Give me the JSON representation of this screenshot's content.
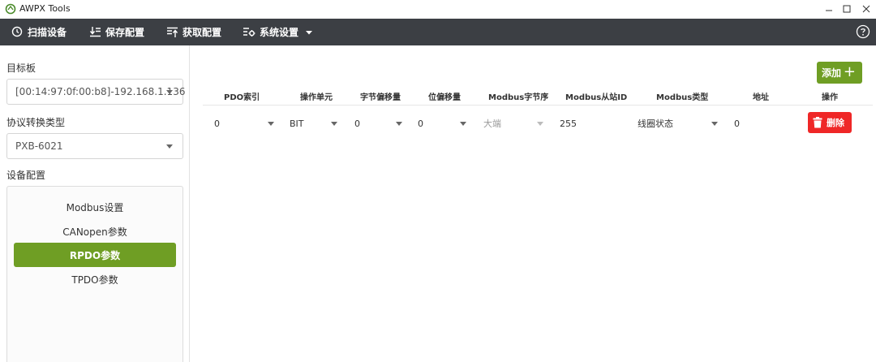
{
  "window": {
    "title": "AWPX Tools"
  },
  "toolbar": {
    "scan": "扫描设备",
    "save": "保存配置",
    "fetch": "获取配置",
    "settings": "系统设置"
  },
  "sidebar": {
    "target_label": "目标板",
    "target_value": "[00:14:97:0f:00:b8]-192.168.1.136",
    "protocol_label": "协议转换类型",
    "protocol_value": "PXB-6021",
    "device_config_label": "设备配置",
    "menu": [
      {
        "label": "Modbus设置",
        "active": false
      },
      {
        "label": "CANopen参数",
        "active": false
      },
      {
        "label": "RPDO参数",
        "active": true
      },
      {
        "label": "TPDO参数",
        "active": false
      }
    ]
  },
  "main": {
    "add_label": "添加",
    "columns": [
      "PDO索引",
      "操作单元",
      "字节偏移量",
      "位偏移量",
      "Modbus字节序",
      "Modbus从站ID",
      "Modbus类型",
      "地址",
      "操作"
    ],
    "rows": [
      {
        "pdo_index": "0",
        "unit": "BIT",
        "byte_offset": "0",
        "bit_offset": "0",
        "byte_order": "大端",
        "slave_id": "255",
        "modbus_type": "线圈状态",
        "address": "0",
        "delete_label": "删除"
      }
    ]
  },
  "colors": {
    "accent": "#6f9e24",
    "danger": "#ef2727",
    "toolbar": "#3c3f44"
  }
}
